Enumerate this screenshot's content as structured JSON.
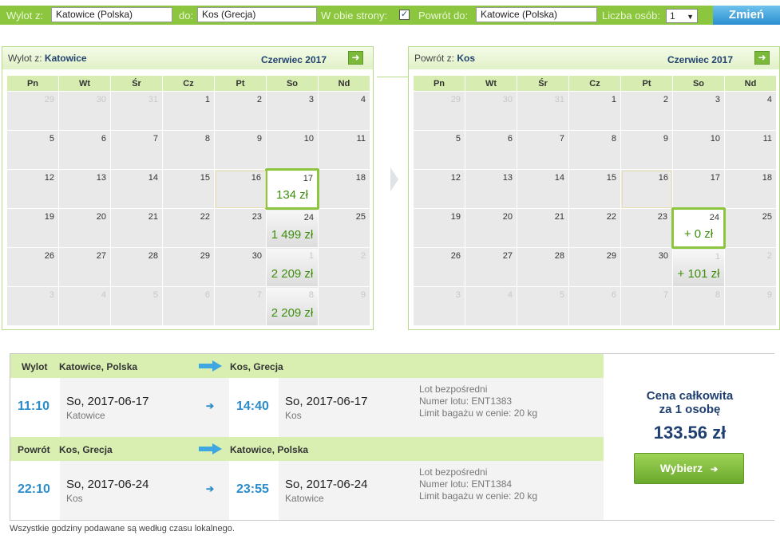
{
  "search": {
    "from_label": "Wylot z:",
    "from_value": "Katowice (Polska)",
    "to_label": "do:",
    "to_value": "Kos (Grecja)",
    "roundtrip_label": "W obie strony:",
    "roundtrip_checked": "✓",
    "return_label": "Powrót do:",
    "return_value": "Katowice (Polska)",
    "persons_label": "Liczba osób:",
    "persons_value": "1",
    "change_label": "Zmień"
  },
  "weekdays": [
    "Pn",
    "Wt",
    "Śr",
    "Cz",
    "Pt",
    "So",
    "Nd"
  ],
  "outbound_calendar": {
    "title_prefix": "Wylot z:",
    "title_city": "Katowice",
    "month": "Czerwiec 2017",
    "weeks": [
      [
        {
          "d": "29",
          "o": 1
        },
        {
          "d": "30",
          "o": 1
        },
        {
          "d": "31",
          "o": 1
        },
        {
          "d": "1"
        },
        {
          "d": "2"
        },
        {
          "d": "3"
        },
        {
          "d": "4"
        }
      ],
      [
        {
          "d": "5"
        },
        {
          "d": "6"
        },
        {
          "d": "7"
        },
        {
          "d": "8"
        },
        {
          "d": "9"
        },
        {
          "d": "10"
        },
        {
          "d": "11"
        }
      ],
      [
        {
          "d": "12"
        },
        {
          "d": "13"
        },
        {
          "d": "14"
        },
        {
          "d": "15"
        },
        {
          "d": "16",
          "t": 1
        },
        {
          "d": "17",
          "p": "134 zł",
          "s": 1
        },
        {
          "d": "18"
        }
      ],
      [
        {
          "d": "19"
        },
        {
          "d": "20"
        },
        {
          "d": "21"
        },
        {
          "d": "22"
        },
        {
          "d": "23"
        },
        {
          "d": "24",
          "p": "1 499 zł"
        },
        {
          "d": "25"
        }
      ],
      [
        {
          "d": "26"
        },
        {
          "d": "27"
        },
        {
          "d": "28"
        },
        {
          "d": "29"
        },
        {
          "d": "30"
        },
        {
          "d": "1",
          "o": 1,
          "p": "2 209 zł"
        },
        {
          "d": "2",
          "o": 1
        }
      ],
      [
        {
          "d": "3",
          "o": 1
        },
        {
          "d": "4",
          "o": 1
        },
        {
          "d": "5",
          "o": 1
        },
        {
          "d": "6",
          "o": 1
        },
        {
          "d": "7",
          "o": 1
        },
        {
          "d": "8",
          "o": 1,
          "p": "2 209 zł"
        },
        {
          "d": "9",
          "o": 1
        }
      ]
    ]
  },
  "return_calendar": {
    "title_prefix": "Powrót z:",
    "title_city": "Kos",
    "month": "Czerwiec 2017",
    "weeks": [
      [
        {
          "d": "29",
          "o": 1
        },
        {
          "d": "30",
          "o": 1
        },
        {
          "d": "31",
          "o": 1
        },
        {
          "d": "1"
        },
        {
          "d": "2"
        },
        {
          "d": "3"
        },
        {
          "d": "4"
        }
      ],
      [
        {
          "d": "5"
        },
        {
          "d": "6"
        },
        {
          "d": "7"
        },
        {
          "d": "8"
        },
        {
          "d": "9"
        },
        {
          "d": "10"
        },
        {
          "d": "11"
        }
      ],
      [
        {
          "d": "12"
        },
        {
          "d": "13"
        },
        {
          "d": "14"
        },
        {
          "d": "15"
        },
        {
          "d": "16",
          "t": 1
        },
        {
          "d": "17"
        },
        {
          "d": "18"
        }
      ],
      [
        {
          "d": "19"
        },
        {
          "d": "20"
        },
        {
          "d": "21"
        },
        {
          "d": "22"
        },
        {
          "d": "23"
        },
        {
          "d": "24",
          "p": "+ 0 zł",
          "s": 1
        },
        {
          "d": "25"
        }
      ],
      [
        {
          "d": "26"
        },
        {
          "d": "27"
        },
        {
          "d": "28"
        },
        {
          "d": "29"
        },
        {
          "d": "30"
        },
        {
          "d": "1",
          "o": 1,
          "p": "+ 101 zł"
        },
        {
          "d": "2",
          "o": 1
        }
      ],
      [
        {
          "d": "3",
          "o": 1
        },
        {
          "d": "4",
          "o": 1
        },
        {
          "d": "5",
          "o": 1
        },
        {
          "d": "6",
          "o": 1
        },
        {
          "d": "7",
          "o": 1
        },
        {
          "d": "8",
          "o": 1
        },
        {
          "d": "9",
          "o": 1
        }
      ]
    ]
  },
  "outbound": {
    "label": "Wylot",
    "from": "Katowice, Polska",
    "to": "Kos, Grecja",
    "dep_time": "11:10",
    "dep_date": "So, 2017-06-17",
    "dep_city": "Katowice",
    "arr_time": "14:40",
    "arr_date": "So, 2017-06-17",
    "arr_city": "Kos",
    "info1": "Lot bezpośredni",
    "info2": "Numer lotu: ENT1383",
    "info3": "Limit bagażu w cenie: 20 kg"
  },
  "inbound": {
    "label": "Powrót",
    "from": "Kos, Grecja",
    "to": "Katowice, Polska",
    "dep_time": "22:10",
    "dep_date": "So, 2017-06-24",
    "dep_city": "Kos",
    "arr_time": "23:55",
    "arr_date": "So, 2017-06-24",
    "arr_city": "Katowice",
    "info1": "Lot bezpośredni",
    "info2": "Numer lotu: ENT1384",
    "info3": "Limit bagażu w cenie: 20 kg"
  },
  "price": {
    "label_line1": "Cena całkowita",
    "label_line2": "za 1 osobę",
    "total": "133.56 zł",
    "choose_label": "Wybierz",
    "choose_icon": "arrow-right-icon"
  },
  "footnote": "Wszystkie godziny podawane są według czasu lokalnego.",
  "colors": {
    "accent_green": "#8cc63f",
    "price_green": "#3e8e0f",
    "time_blue": "#2a8ccb",
    "navy": "#1f3f70"
  }
}
